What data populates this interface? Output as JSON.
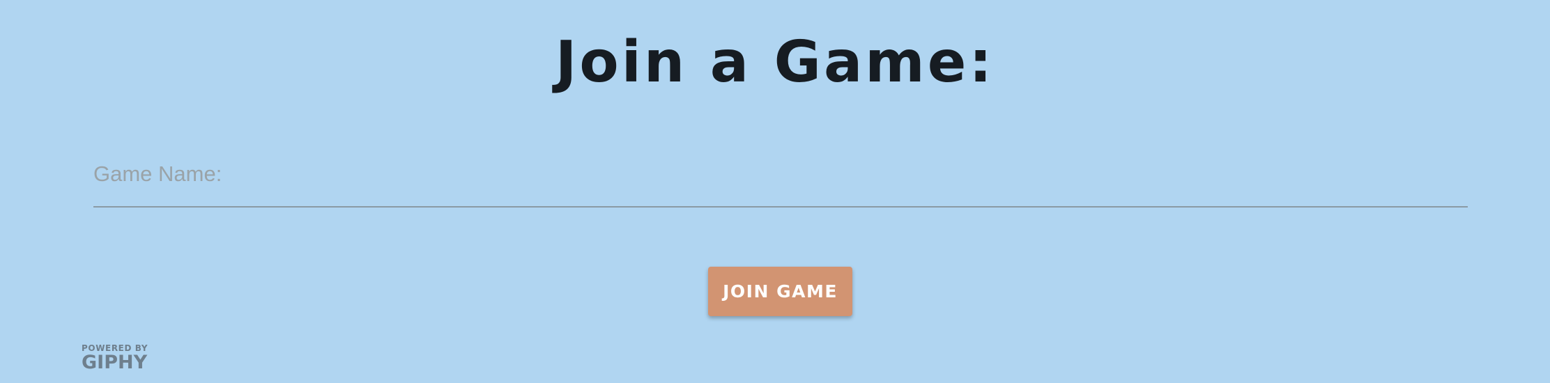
{
  "page": {
    "title": "Join a Game:"
  },
  "form": {
    "game_name_placeholder": "Game Name:",
    "game_name_value": ""
  },
  "actions": {
    "join_label": "JOIN GAME"
  },
  "footer": {
    "powered_by": "POWERED BY",
    "brand": "GIPHY"
  },
  "colors": {
    "background": "#b0d5f1",
    "button": "#d29472",
    "title": "#161c22"
  }
}
